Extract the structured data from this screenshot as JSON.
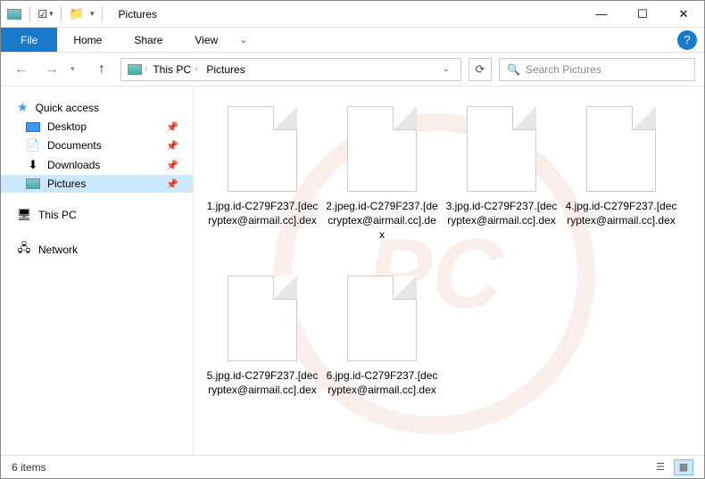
{
  "titlebar": {
    "title": "Pictures"
  },
  "ribbon": {
    "file": "File",
    "tabs": [
      "Home",
      "Share",
      "View"
    ]
  },
  "nav": {
    "up_enabled": true
  },
  "breadcrumbs": [
    "This PC",
    "Pictures"
  ],
  "search": {
    "placeholder": "Search Pictures"
  },
  "sidebar": {
    "quick_access": "Quick access",
    "items": [
      {
        "label": "Desktop",
        "pinned": true
      },
      {
        "label": "Documents",
        "pinned": true
      },
      {
        "label": "Downloads",
        "pinned": true
      },
      {
        "label": "Pictures",
        "pinned": true,
        "selected": true
      }
    ],
    "this_pc": "This PC",
    "network": "Network"
  },
  "files": [
    {
      "name": "1.jpg.id-C279F237.[decryptex@airmail.cc].dex"
    },
    {
      "name": "2.jpeg.id-C279F237.[decryptex@airmail.cc].dex"
    },
    {
      "name": "3.jpg.id-C279F237.[decryptex@airmail.cc].dex"
    },
    {
      "name": "4.jpg.id-C279F237.[decryptex@airmail.cc].dex"
    },
    {
      "name": "5.jpg.id-C279F237.[decryptex@airmail.cc].dex"
    },
    {
      "name": "6.jpg.id-C279F237.[decryptex@airmail.cc].dex"
    }
  ],
  "status": {
    "text": "6 items"
  }
}
